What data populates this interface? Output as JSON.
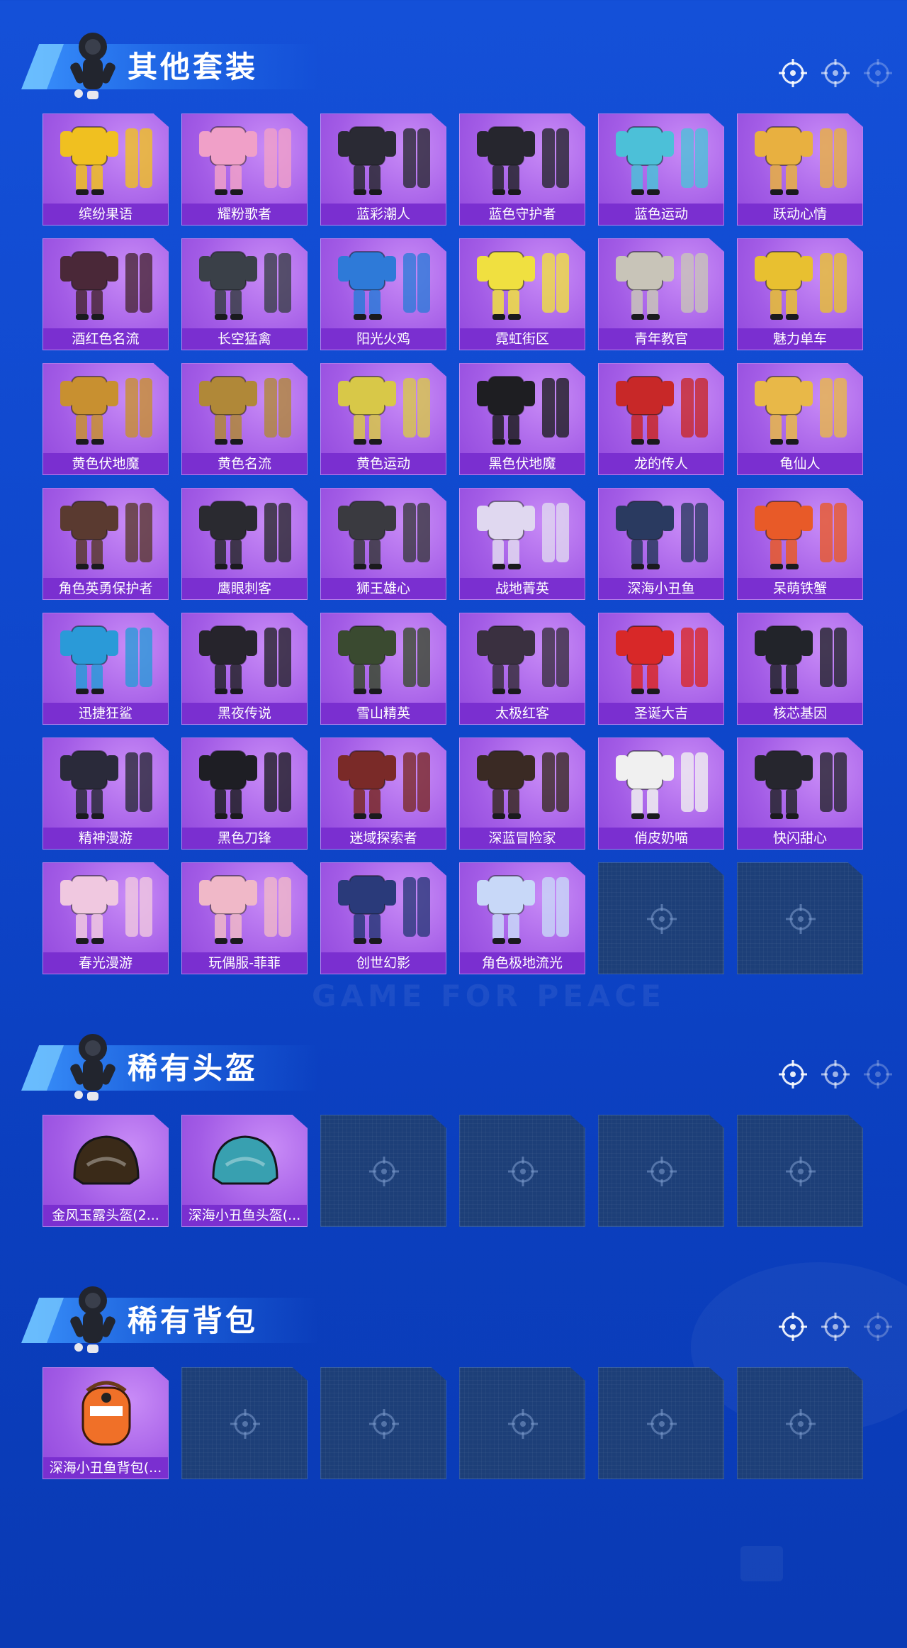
{
  "background": {
    "watermark": "GAME FOR PEACE"
  },
  "colors": {
    "background": "#1450d8",
    "card_purple": "#a35ce6",
    "label_bar": "#7a2fd0",
    "empty_slot": "#1d3f78"
  },
  "sections": [
    {
      "title": "其他套装",
      "items": [
        {
          "label": "缤纷果语",
          "icon": "outfit-icon",
          "color": "#f0c020"
        },
        {
          "label": "耀粉歌者",
          "icon": "outfit-icon",
          "color": "#f0a0c8"
        },
        {
          "label": "蓝彩潮人",
          "icon": "outfit-icon",
          "color": "#2a2a34"
        },
        {
          "label": "蓝色守护者",
          "icon": "outfit-icon",
          "color": "#26262e"
        },
        {
          "label": "蓝色运动",
          "icon": "outfit-icon",
          "color": "#4cc0d8"
        },
        {
          "label": "跃动心情",
          "icon": "outfit-icon",
          "color": "#e8b040"
        },
        {
          "label": "酒红色名流",
          "icon": "outfit-icon",
          "color": "#4a2838"
        },
        {
          "label": "长空猛禽",
          "icon": "outfit-icon",
          "color": "#3a4048"
        },
        {
          "label": "阳光火鸡",
          "icon": "outfit-icon",
          "color": "#2e7ad8"
        },
        {
          "label": "霓虹街区",
          "icon": "outfit-icon",
          "color": "#f0e040"
        },
        {
          "label": "青年教官",
          "icon": "outfit-icon",
          "color": "#c8c4b8"
        },
        {
          "label": "魅力单车",
          "icon": "outfit-icon",
          "color": "#e8c030"
        },
        {
          "label": "黄色伏地魔",
          "icon": "outfit-icon",
          "color": "#c89030"
        },
        {
          "label": "黄色名流",
          "icon": "outfit-icon",
          "color": "#b08838"
        },
        {
          "label": "黄色运动",
          "icon": "outfit-icon",
          "color": "#d8c848"
        },
        {
          "label": "黑色伏地魔",
          "icon": "outfit-icon",
          "color": "#1e1e22"
        },
        {
          "label": "龙的传人",
          "icon": "outfit-icon",
          "color": "#c82828"
        },
        {
          "label": "龟仙人",
          "icon": "outfit-icon",
          "color": "#e8b848"
        },
        {
          "label": "角色英勇保护者",
          "icon": "outfit-icon",
          "color": "#5a3a30"
        },
        {
          "label": "鹰眼刺客",
          "icon": "outfit-icon",
          "color": "#2a2a30"
        },
        {
          "label": "狮王雄心",
          "icon": "outfit-icon",
          "color": "#3a3a40"
        },
        {
          "label": "战地菁英",
          "icon": "outfit-icon",
          "color": "#e0d8f0"
        },
        {
          "label": "深海小丑鱼",
          "icon": "outfit-icon",
          "color": "#2a3a60"
        },
        {
          "label": "呆萌铁蟹",
          "icon": "outfit-icon",
          "color": "#e85a28"
        },
        {
          "label": "迅捷狂鲨",
          "icon": "outfit-icon",
          "color": "#2a9ad8"
        },
        {
          "label": "黑夜传说",
          "icon": "outfit-icon",
          "color": "#26242c"
        },
        {
          "label": "雪山精英",
          "icon": "outfit-icon",
          "color": "#3a4a30"
        },
        {
          "label": "太极红客",
          "icon": "outfit-icon",
          "color": "#3a3040"
        },
        {
          "label": "圣诞大吉",
          "icon": "outfit-icon",
          "color": "#d82828"
        },
        {
          "label": "核芯基因",
          "icon": "outfit-icon",
          "color": "#22242a"
        },
        {
          "label": "精神漫游",
          "icon": "outfit-icon",
          "color": "#2a2a3a"
        },
        {
          "label": "黑色刀锋",
          "icon": "outfit-icon",
          "color": "#1e1e24"
        },
        {
          "label": "迷域探索者",
          "icon": "outfit-icon",
          "color": "#7a2a28"
        },
        {
          "label": "深蓝冒险家",
          "icon": "outfit-icon",
          "color": "#3a2a24"
        },
        {
          "label": "俏皮奶喵",
          "icon": "outfit-icon",
          "color": "#f0f0f0"
        },
        {
          "label": "快闪甜心",
          "icon": "outfit-icon",
          "color": "#26262e"
        },
        {
          "label": "春光漫游",
          "icon": "outfit-icon",
          "color": "#f0c8e0"
        },
        {
          "label": "玩偶服-菲菲",
          "icon": "outfit-icon",
          "color": "#f0b8c8"
        },
        {
          "label": "创世幻影",
          "icon": "outfit-icon",
          "color": "#2a3a7a"
        },
        {
          "label": "角色极地流光",
          "icon": "outfit-icon",
          "color": "#c8d8f8"
        }
      ],
      "empty_slots": 2
    },
    {
      "title": "稀有头盔",
      "items": [
        {
          "label": "金风玉露头盔(2...",
          "icon": "helmet-icon",
          "color": "#3a2a18"
        },
        {
          "label": "深海小丑鱼头盔(...",
          "icon": "helmet-icon",
          "color": "#38a0b0"
        }
      ],
      "empty_slots": 4
    },
    {
      "title": "稀有背包",
      "items": [
        {
          "label": "深海小丑鱼背包(...",
          "icon": "backpack-icon",
          "color": "#f07028"
        }
      ],
      "empty_slots": 5
    }
  ]
}
